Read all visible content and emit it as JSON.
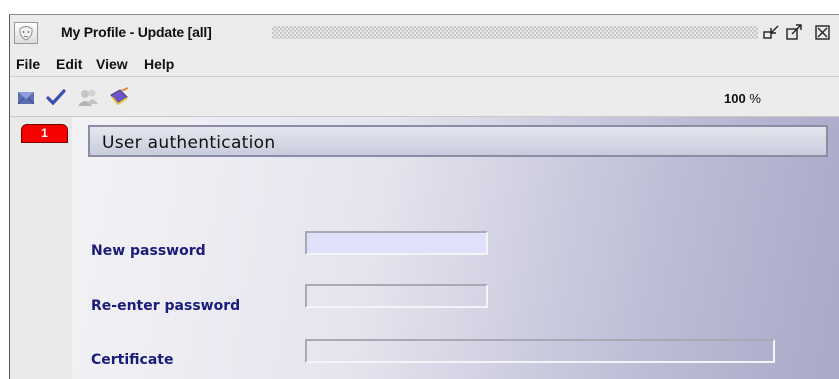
{
  "window": {
    "title": "My Profile - Update [all]",
    "controls": [
      "minimize-icon",
      "maximize-icon",
      "close-icon"
    ]
  },
  "menu": [
    "File",
    "Edit",
    "View",
    "Help"
  ],
  "toolbar": {
    "tools": [
      "envelope-icon",
      "checkmark-icon",
      "users-icon",
      "notebook-pencil-icon"
    ],
    "zoom_value": "100",
    "zoom_unit": "%"
  },
  "tabs": [
    {
      "label": "1",
      "color": "#f80000"
    }
  ],
  "section": {
    "title": "User authentication",
    "fields": [
      {
        "label": "New password",
        "value": ""
      },
      {
        "label": "Re-enter password",
        "value": ""
      },
      {
        "label": "Certificate",
        "value": ""
      }
    ]
  },
  "colors": {
    "label_text": "#1b1b7a",
    "active_input": "#e0e0fa"
  }
}
